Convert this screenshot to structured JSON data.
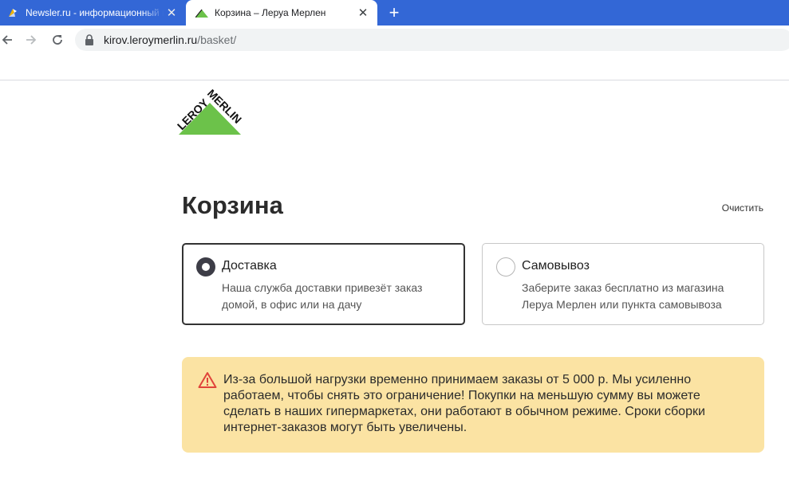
{
  "browser": {
    "tabs": [
      {
        "title": "Newsler.ru - информационный портал",
        "active": false
      },
      {
        "title": "Корзина – Леруа Мерлен",
        "active": true
      }
    ],
    "address": {
      "host": "kirov.leroymerlin.ru",
      "path": "/basket/"
    }
  },
  "brand": {
    "logo_text_1": "LEROY",
    "logo_text_2": "MERLIN",
    "color_green": "#6cc24a"
  },
  "page": {
    "title": "Корзина",
    "clear_label": "Очистить"
  },
  "delivery_options": [
    {
      "title": "Доставка",
      "description": "Наша служба доставки привезёт заказ домой, в офис или на дачу",
      "selected": true
    },
    {
      "title": "Самовывоз",
      "description": "Заберите заказ бесплатно из магазина Леруа Мерлен или пункта самовывоза",
      "selected": false
    }
  ],
  "notice": {
    "text": "Из-за большой нагрузки временно принимаем заказы от 5 000 р. Мы усиленно работаем, чтобы снять это ограничение! Покупки на меньшую сумму вы можете сделать в наших гипермаркетах, они работают в обычном режиме. Сроки сборки интернет-заказов могут быть увеличены.",
    "color_bg": "#fbe3a3",
    "color_icon": "#e0433a"
  }
}
